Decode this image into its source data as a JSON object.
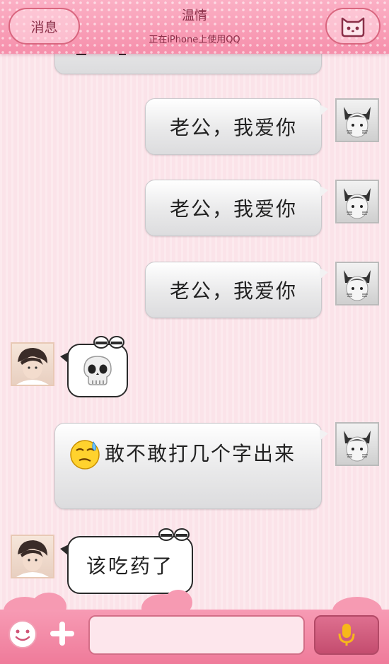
{
  "header": {
    "back_label": "消息",
    "title": "温情",
    "subtitle": "正在iPhone上使用QQ",
    "menu_icon": "cat-face-icon"
  },
  "messages": [
    {
      "side": "right",
      "text": "老公，我爱你"
    },
    {
      "side": "right",
      "text": "老公，我爱你"
    },
    {
      "side": "right",
      "text": "老公，我爱你"
    },
    {
      "side": "left",
      "icon": "skull-emoji"
    },
    {
      "side": "right",
      "text": "敢不敢打几个字出来",
      "icon": "sweat-emoji"
    },
    {
      "side": "left",
      "text": "该吃药了"
    }
  ],
  "input": {
    "value": "",
    "left_icons": [
      "smiley-icon",
      "plus-icon"
    ],
    "voice_icon": "microphone-icon"
  },
  "colors": {
    "header_pink": "#f68fab",
    "background": "#fbe3e9",
    "accent_dark": "#8a2f48",
    "mic_yellow": "#f7b81a"
  }
}
